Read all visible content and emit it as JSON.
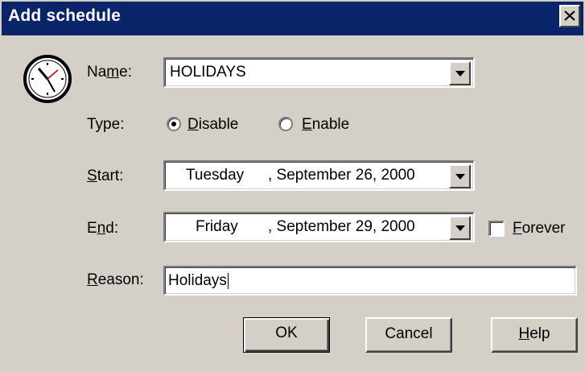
{
  "window": {
    "title": "Add schedule",
    "close_icon": "close-icon"
  },
  "form": {
    "name": {
      "label_pre": "Na",
      "label_ul": "m",
      "label_post": "e:",
      "value": "HOLIDAYS"
    },
    "type": {
      "label": "Type:",
      "options": [
        {
          "ul": "D",
          "rest": "isable",
          "selected": true
        },
        {
          "ul": "E",
          "rest": "nable",
          "selected": false
        }
      ]
    },
    "start": {
      "label_ul": "S",
      "label_post": "tart:",
      "day": "Tuesday",
      "date": ", September 26, 2000"
    },
    "end": {
      "label_pre": "E",
      "label_ul": "n",
      "label_post": "d:",
      "day": "Friday",
      "date": ", September 29, 2000"
    },
    "forever": {
      "label_ul": "F",
      "label_post": "orever",
      "checked": false
    },
    "reason": {
      "label_ul": "R",
      "label_post": "eason:",
      "value": "Holidays"
    }
  },
  "buttons": {
    "ok": "OK",
    "cancel": "Cancel",
    "help_ul": "H",
    "help_post": "elp"
  },
  "colors": {
    "titlebar": "#0a246a",
    "face": "#d4d0c8"
  }
}
